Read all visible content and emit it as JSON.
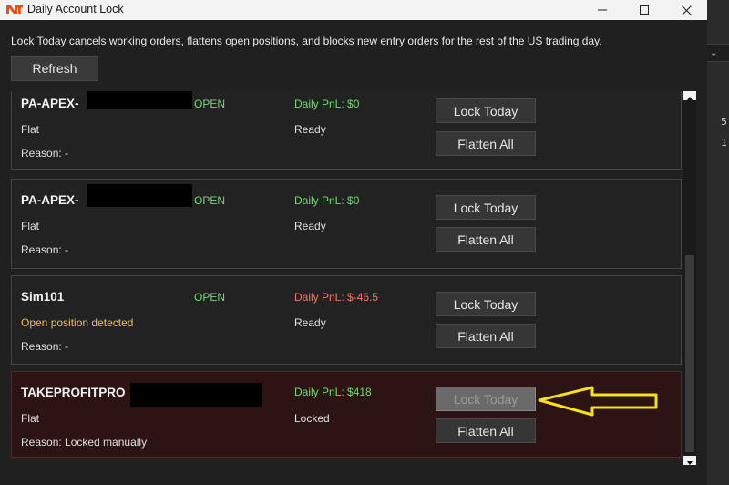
{
  "window": {
    "title": "Daily Account Lock",
    "description": "Lock Today cancels working orders, flattens open positions, and blocks new entry orders for the rest of the US trading day.",
    "refresh_label": "Refresh"
  },
  "accounts": [
    {
      "name": "PA-APEX-",
      "status": "OPEN",
      "pnl": "Daily PnL: $0",
      "position": "Flat",
      "state": "Ready",
      "reason": "Reason: -",
      "lock_label": "Lock Today",
      "flatten_label": "Flatten All"
    },
    {
      "name": "PA-APEX-",
      "status": "OPEN",
      "pnl": "Daily PnL: $0",
      "position": "Flat",
      "state": "Ready",
      "reason": "Reason: -",
      "lock_label": "Lock Today",
      "flatten_label": "Flatten All"
    },
    {
      "name": "Sim101",
      "status": "OPEN",
      "pnl": "Daily PnL: $-46.5",
      "position": "Open position detected",
      "state": "Ready",
      "reason": "Reason: -",
      "lock_label": "Lock Today",
      "flatten_label": "Flatten All"
    },
    {
      "name": "TAKEPROFITPRO",
      "status": "",
      "pnl": "Daily PnL: $418",
      "position": "Flat",
      "state": "Locked",
      "reason": "Reason: Locked manually",
      "lock_label": "Lock Today",
      "flatten_label": "Flatten All"
    }
  ],
  "background_app": {
    "values": [
      "5",
      "1"
    ]
  },
  "colors": {
    "positive": "#6fdc6f",
    "negative": "#f0776b",
    "warning": "#f0c04a",
    "locked_card": "#2c1414",
    "annotation_arrow": "#f5e21a"
  },
  "icons": {
    "app_logo": "nt-logo-icon",
    "minimize": "minimize-icon",
    "maximize": "maximize-icon",
    "close": "close-icon",
    "annotation": "arrow-left-icon"
  }
}
